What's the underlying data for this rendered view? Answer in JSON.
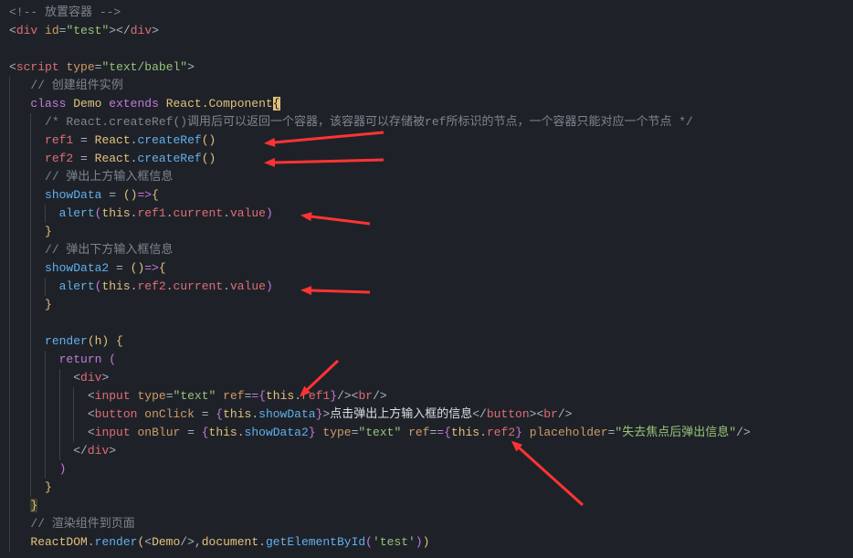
{
  "code": {
    "l1": {
      "comment_open": "<!--",
      "comment_text": " 放置容器 ",
      "comment_close": "-->"
    },
    "l2": {
      "open_angle": "<",
      "tag": "div",
      "attr": "id",
      "eq": "=",
      "q": "\"",
      "val": "test",
      "close": ">",
      "open_angle2": "</",
      "close2": ">"
    },
    "l3": "",
    "l4": {
      "open_angle": "<",
      "tag": "script",
      "attr": "type",
      "eq": "=",
      "q": "\"",
      "val": "text/babel",
      "close": ">"
    },
    "l5": {
      "comment": "// 创建组件实例"
    },
    "l6": {
      "kw1": "class",
      "name": "Demo",
      "kw2": "extends",
      "super": "React.Component",
      "brace": "{"
    },
    "l7": {
      "comment": "/* React.createRef()调用后可以返回一个容器，该容器可以存储被ref所标识的节点，一个容器只能对应一个节点 */"
    },
    "l8": {
      "prop": "ref1",
      "op": " = ",
      "obj": "React",
      "dot": ".",
      "fn": "createRef",
      "paren": "()"
    },
    "l9": {
      "prop": "ref2",
      "op": " = ",
      "obj": "React",
      "dot": ".",
      "fn": "createRef",
      "paren": "()"
    },
    "l10": {
      "comment": "// 弹出上方输入框信息"
    },
    "l11": {
      "prop": "showData",
      "op": " = ",
      "paren": "()",
      "arrow": "=>",
      "brace": "{"
    },
    "l12": {
      "fn": "alert",
      "open": "(",
      "this": "this",
      "dot": ".",
      "p1": "ref1",
      "p2": "current",
      "p3": "value",
      "close": ")"
    },
    "l13": {
      "brace": "}"
    },
    "l14": {
      "comment": "// 弹出下方输入框信息"
    },
    "l15": {
      "prop": "showData2",
      "op": " = ",
      "paren": "()",
      "arrow": "=>",
      "brace": "{"
    },
    "l16": {
      "fn": "alert",
      "open": "(",
      "this": "this",
      "dot": ".",
      "p1": "ref2",
      "p2": "current",
      "p3": "value",
      "close": ")"
    },
    "l17": {
      "brace": "}"
    },
    "l18": "",
    "l19": {
      "fn": "render",
      "paren": "(h) ",
      "brace": "{"
    },
    "l20": {
      "kw": "return",
      "paren": " ("
    },
    "l21": {
      "open": "<",
      "tag": "div",
      "close": ">"
    },
    "l22": {
      "open": "<",
      "tag": "input",
      "a1": "type",
      "eq": "=",
      "q": "\"",
      "v1": "text",
      "a2": "ref",
      "bro": "={",
      "this": "this",
      "dot": ".",
      "p": "ref1",
      "brc": "}",
      "sc": "/>",
      "open2": "<",
      "tag2": "br",
      "sc2": "/>"
    },
    "l23": {
      "open": "<",
      "tag": "button",
      "a1": "onClick",
      "eq": " = ",
      "bro": "{",
      "this": "this",
      "dot": ".",
      "p": "showData",
      "brc": "}",
      "close": ">",
      "text": "点击弹出上方输入框的信息",
      "open2": "</",
      "close2": ">",
      "open3": "<",
      "tag3": "br",
      "sc3": "/>"
    },
    "l24": {
      "open": "<",
      "tag": "input",
      "a1": "onBlur",
      "eq": " = ",
      "bro": "{",
      "this": "this",
      "dot": ".",
      "p": "showData2",
      "brc": "}",
      "a2": "type",
      "eq2": "=",
      "q": "\"",
      "v2": "text",
      "a3": "ref",
      "bro2": "={",
      "this2": "this",
      "dot2": ".",
      "p2": "ref2",
      "brc2": "}",
      "a4": "placeholder",
      "eq3": "=",
      "v4": "失去焦点后弹出信息",
      "sc": "/>"
    },
    "l25": {
      "open": "</",
      "tag": "div",
      "close": ">"
    },
    "l26": {
      "paren": ")"
    },
    "l27": {
      "brace": "}"
    },
    "l28": {
      "brace": "}"
    },
    "l29": {
      "comment": "// 渲染组件到页面"
    },
    "l30": {
      "obj": "ReactDOM",
      "dot": ".",
      "fn": "render",
      "open": "(",
      "lt": "<",
      "comp": "Demo",
      "sc": "/>",
      "comma": ",",
      "doc": "document",
      "dot2": ".",
      "fn2": "getElementById",
      "open2": "(",
      "str": "'test'",
      "close2": ")",
      "close": ")"
    }
  },
  "annotations": {
    "arrow_color": "#ff3333"
  }
}
